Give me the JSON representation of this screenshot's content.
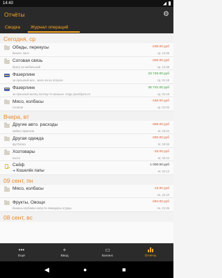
{
  "status": {
    "time": "14:40"
  },
  "app": {
    "title": "Отчёты"
  },
  "tabs": [
    {
      "label": "Сводка"
    },
    {
      "label": "Журнал операций"
    }
  ],
  "sections": [
    {
      "title": "Сегодня, ср",
      "rows": [
        {
          "kind": "folder",
          "name": "Обеды, перекусы",
          "sub": "бизнес ланч",
          "amount": "-235.00 руб",
          "amount_type": "neg",
          "date": "ср, 13:38"
        },
        {
          "kind": "folder",
          "name": "Сотовая связь",
          "sub": "брату на мобильный",
          "amount": "-300.00 руб",
          "amount_type": "neg",
          "date": "ср, 12:38"
        },
        {
          "kind": "card",
          "name": "Фазерлинк",
          "sub": "за прошлый мес.. мало из-за отпуска",
          "amount": "23 740.00 руб",
          "amount_type": "pos",
          "date": "ср, 01:18"
        },
        {
          "kind": "card",
          "name": "Фазерлинк",
          "sub": "за прошлый месяц почему-то меньше. Надо разобраться.",
          "amount": "25 731.00 руб",
          "amount_type": "pos",
          "date": "ср, 01:18"
        },
        {
          "kind": "folder",
          "name": "Мясо, колбасы",
          "sub": "сосиски",
          "amount": "-160.00 руб",
          "amount_type": "neg",
          "date": "ср, 01:03"
        }
      ]
    },
    {
      "title": "Вчера, вт",
      "rows": [
        {
          "kind": "folder",
          "name": "Другие авто. расходы",
          "sub": "мойка тормозов",
          "amount": "-355.00 руб",
          "amount_type": "neg",
          "date": "вт, 23:24"
        },
        {
          "kind": "folder",
          "name": "Другая одежда",
          "sub": "футболка",
          "amount": "-250.00 руб",
          "amount_type": "neg",
          "date": "вт, 18:45"
        },
        {
          "kind": "folder",
          "name": "Хозтовары",
          "sub": "паста",
          "amount": "-33.00 руб",
          "amount_type": "neg",
          "date": "вт, 02:24"
        },
        {
          "kind": "transfer",
          "name": "Сейф",
          "target": "Кошелёк папы",
          "amount": "1 000.00 руб",
          "amount_type": "neu",
          "date": "вт, 02:13"
        }
      ]
    },
    {
      "title": "09 сент, пн",
      "rows": [
        {
          "kind": "folder",
          "name": "Мясо, колбасы",
          "sub": "",
          "amount": "-13.00 руб",
          "amount_type": "neg",
          "date": "пн, 22:10"
        },
        {
          "kind": "folder",
          "name": "Фрукты, Овощи",
          "sub": "бананы клубника капуста помидоры огурцы",
          "amount": "-284.00 руб",
          "amount_type": "neg",
          "date": "пн, 21:35"
        }
      ]
    },
    {
      "title": "08 сент, вс",
      "rows": []
    }
  ],
  "bottom_nav": [
    {
      "icon": "more-icon",
      "glyph": "•••",
      "label": "Ещё"
    },
    {
      "icon": "plus-icon",
      "glyph": "+",
      "label": "Ввод"
    },
    {
      "icon": "balance-icon",
      "glyph": "▭",
      "label": "Баланс"
    },
    {
      "icon": "reports-icon",
      "glyph": "",
      "label": "Отчёты"
    }
  ],
  "colors": {
    "accent": "#f5a623",
    "negative": "#d45a2b",
    "positive": "#2e9a2e",
    "bar": "#2a2a2a"
  }
}
